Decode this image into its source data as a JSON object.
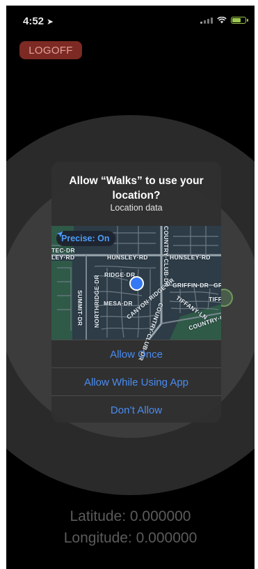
{
  "status_bar": {
    "time": "4:52",
    "location_arrow": "location-arrow-icon"
  },
  "logoff_label": "LOGOFF",
  "alert": {
    "title": "Allow “Walks” to use your location?",
    "subtitle": "Location data",
    "precise_label": "Precise: On",
    "map_labels": {
      "tec_dr": "TEC·DR",
      "ley_rd": "LEY·RD",
      "hunsley_1": "HUNSLEY·RD",
      "hunsley_2": "HUNSLEY·RD",
      "country_club_1": "COUNTRY·CLUB·DR",
      "ridge_dr": "RIDGE·DR",
      "griffin": "GRIFFIN·DR",
      "gr": "GR",
      "northridge": "NORTHRIDGE·DR",
      "summit": "SUMMIT·DR",
      "mesa": "MESA·DR",
      "tiffany": "TIFFANY·LN",
      "tiffa": "TIFFA",
      "canyon": "CANYON·RIDGE·DR",
      "country_club_2": "COUNTRY·CLUB·DR",
      "country_3": "COUNTRY·CLU"
    },
    "buttons": {
      "allow_once": "Allow Once",
      "allow_while_using": "Allow While Using App",
      "dont_allow": "Don’t Allow"
    }
  },
  "coordinates": {
    "latitude": "Latitude: 0.000000",
    "longitude": "Longitude: 0.000000"
  },
  "colors": {
    "logoff_bg": "#7c2a23",
    "alert_button_text": "#4a8cf1",
    "precise_text": "#4f9cf6"
  }
}
